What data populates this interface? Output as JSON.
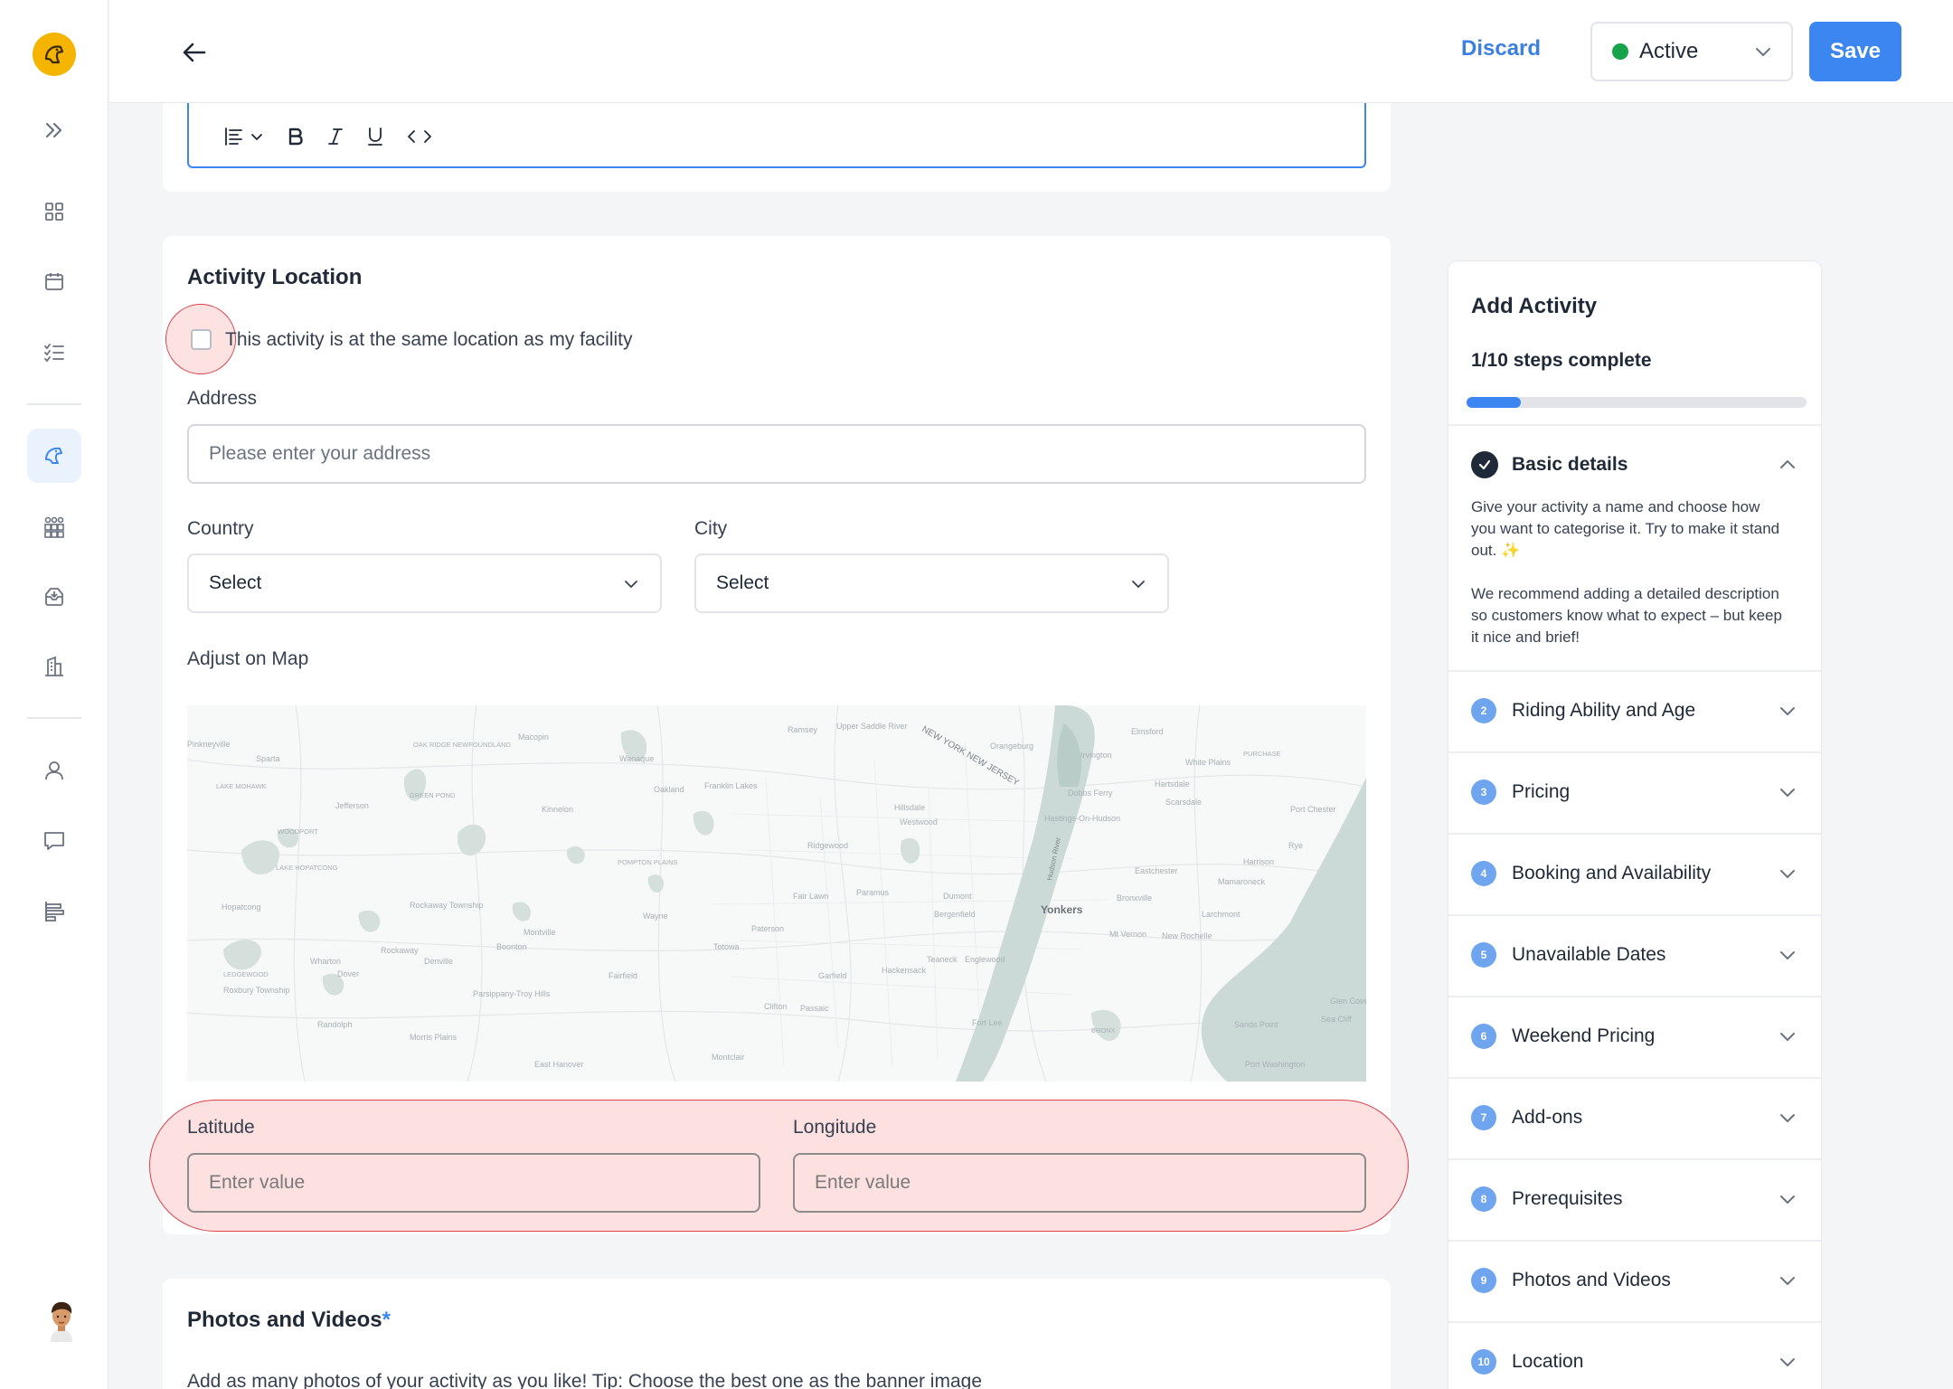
{
  "header": {
    "discard_label": "Discard",
    "status_value": "Active",
    "save_label": "Save"
  },
  "location": {
    "title": "Activity Location",
    "same_location_label": "This activity is at the same location as my facility",
    "address_label": "Address",
    "address_placeholder": "Please enter your address",
    "country_label": "Country",
    "country_value": "Select",
    "city_label": "City",
    "city_value": "Select",
    "map_label": "Adjust on Map",
    "latitude_label": "Latitude",
    "latitude_placeholder": "Enter value",
    "longitude_label": "Longitude",
    "longitude_placeholder": "Enter value"
  },
  "map_labels": {
    "pinkneyville": "Pinkneyville",
    "sparta": "Sparta",
    "lake_mohawk": "LAKE MOHAWK",
    "oak_ridge": "OAK RIDGE NEWFOUNDLAND",
    "macopin": "Macopin",
    "wanaque": "Wanaque",
    "ramsey": "Ramsey",
    "upper_saddle": "Upper Saddle River",
    "ny_nj": "NEW YORK NEW JERSEY",
    "orangeburg": "Orangeburg",
    "elmsford": "Elmsford",
    "irvington": "Irvington",
    "white_plains": "White Plains",
    "purchase": "PURCHASE",
    "jefferson": "Jefferson",
    "green_pond": "GREEN POND",
    "oakland": "Oakland",
    "franklin_lakes": "Franklin Lakes",
    "kinnelon": "Kinnelon",
    "hillsdale": "Hillsdale",
    "westwood": "Westwood",
    "dobbs_ferry": "Dobbs Ferry",
    "hartsdale": "Hartsdale",
    "scarsdale": "Scarsdale",
    "port_chester": "Port Chester",
    "hastings": "Hastings-On-Hudson",
    "woodport": "WOODPORT",
    "lake_hopatcong": "LAKE HOPATCONG",
    "pompton_plains": "POMPTON PLAINS",
    "ridgewood": "Ridgewood",
    "rye": "Rye",
    "harrison": "Harrison",
    "eastchester": "Eastchester",
    "mamaroneck": "Mamaroneck",
    "hopatcong": "Hopatcong",
    "fair_lawn": "Fair Lawn",
    "paramus": "Paramus",
    "dumont": "Dumont",
    "bronxville": "Bronxville",
    "rockaway_twp": "Rockaway Township",
    "wayne": "Wayne",
    "bergenfield": "Bergenfield",
    "yonkers": "Yonkers",
    "larchmont": "Larchmont",
    "montville": "Montville",
    "paterson": "Paterson",
    "mt_vernon": "Mt Vernon",
    "new_rochelle": "New Rochelle",
    "rockaway": "Rockaway",
    "boonton": "Boonton",
    "totowa": "Totowa",
    "teaneck": "Teaneck",
    "englewood": "Englewood",
    "wharton": "Wharton",
    "denville": "Denville",
    "hackensack": "Hackensack",
    "ledgewood": "LEDGEWOOD",
    "dover": "Dover",
    "fairfield": "Fairfield",
    "garfield": "Garfield",
    "roxbury_twp": "Roxbury Township",
    "parsippany": "Parsippany-Troy Hills",
    "glen_cove": "Glen Cove",
    "clifton": "Clifton",
    "passaic": "Passaic",
    "sea_cliff": "Sea Cliff",
    "randolph": "Randolph",
    "fort_lee": "Fort Lee",
    "sands_point": "Sands Point",
    "bronx": "BRONX",
    "morris_plains": "Morris Plains",
    "montclair": "Montclair",
    "port_washington": "Port Washington",
    "east_hanover": "East Hanover",
    "hudson_river": "Hudson River"
  },
  "photos": {
    "title": "Photos and Videos",
    "required_mark": "*",
    "tip": "Add as many photos of your activity as you like! Tip: Choose the best one as the banner image"
  },
  "steps": {
    "title": "Add Activity",
    "progress_text": "1/10 steps complete",
    "progress_fraction": 0.1,
    "basic": {
      "label": "Basic details",
      "desc1": "Give your activity a name and choose how you want to categorise it. Try to make it stand out.",
      "sparkle": "✨",
      "desc2": "We recommend adding a detailed description so customers know what to expect – but keep it nice and brief!"
    },
    "items": [
      {
        "num": "2",
        "label": "Riding Ability and Age"
      },
      {
        "num": "3",
        "label": "Pricing"
      },
      {
        "num": "4",
        "label": "Booking and Availability"
      },
      {
        "num": "5",
        "label": "Unavailable Dates"
      },
      {
        "num": "6",
        "label": "Weekend Pricing"
      },
      {
        "num": "7",
        "label": "Add-ons"
      },
      {
        "num": "8",
        "label": "Prerequisites"
      },
      {
        "num": "9",
        "label": "Photos and Videos"
      },
      {
        "num": "10",
        "label": "Location"
      }
    ]
  },
  "colors": {
    "accent": "#3b86f0",
    "status_green": "#16a34a",
    "highlight": "#fde0e0",
    "logo": "#f5b400"
  }
}
